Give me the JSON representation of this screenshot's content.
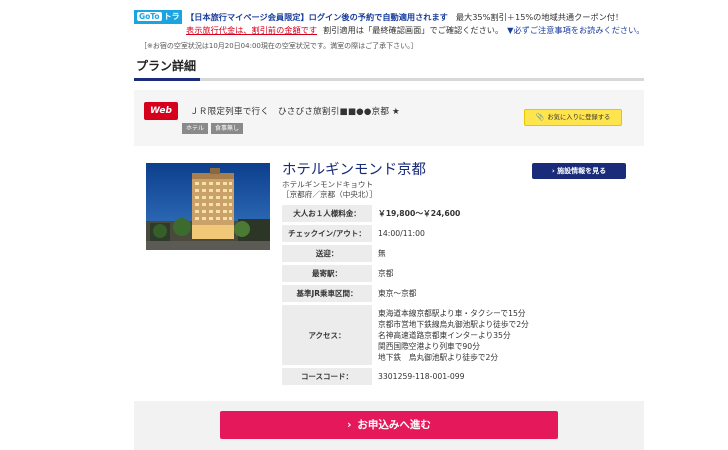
{
  "notice": {
    "logo_goto": "GoTo",
    "logo_travel": "トラベル",
    "member_highlight": "【日本旅行マイページ会員限定】ログイン後の予約で自動適用されます",
    "discount_text": "最大35%割引＋15%の地域共通クーポン付！",
    "price_note": "表示旅行代金は、割引前の金額です",
    "confirm_note": "割引適用は「最終確認画面」でご確認ください。",
    "caution_link": "▼必ずご注意事項をお読みください。"
  },
  "vacancy_note": "［※お宿の空室状況は10月20日04:00現在の空室状況です。満室の際はご了承下さい。］",
  "section": {
    "title": "プラン詳細"
  },
  "plan": {
    "badge": "Web",
    "name": "ＪＲ限定列車で行く　ひさびさ旅割引■■●●京都 ★",
    "tags": [
      "ホテル",
      "食事無し"
    ],
    "favorite_label": "お気に入りに登録する",
    "favorite_icon": "paperclip-icon"
  },
  "hotel": {
    "name": "ホテルギンモンド京都",
    "kana": "ホテルギンモンドキョウト",
    "area": "［京都府／京都（中央北）］",
    "facility_button": "施設情報を見る"
  },
  "info": {
    "price": {
      "label": "大人お１人様料金：",
      "value": "￥19,800〜￥24,600"
    },
    "checkin": {
      "label": "チェックイン/アウト：",
      "value": "14:00/11:00"
    },
    "shuttle": {
      "label": "送迎：",
      "value": "無"
    },
    "nearest_station": {
      "label": "最寄駅：",
      "value": "京都"
    },
    "jr_section": {
      "label": "基準JR乗車区間：",
      "value": "東京〜京都"
    },
    "access": {
      "label": "アクセス：",
      "lines": [
        "東海道本線京都駅より車・タクシーで15分",
        "京都市営地下鉄線烏丸御池駅より徒歩で2分",
        "名神高速道路京都東インターより35分",
        "関西国際空港より列車で90分",
        "地下鉄　烏丸御池駅より徒歩で2分"
      ]
    },
    "course_code": {
      "label": "コースコード：",
      "value": "3301259-118-001-099"
    }
  },
  "apply": {
    "label": "お申込みへ進む",
    "icon": "chevron-right-icon"
  },
  "colors": {
    "navy": "#1a2b7a",
    "pink": "#e5185b",
    "red": "#d6001c",
    "yellow": "#ffe54d",
    "goto_blue": "#1aa5e0"
  }
}
